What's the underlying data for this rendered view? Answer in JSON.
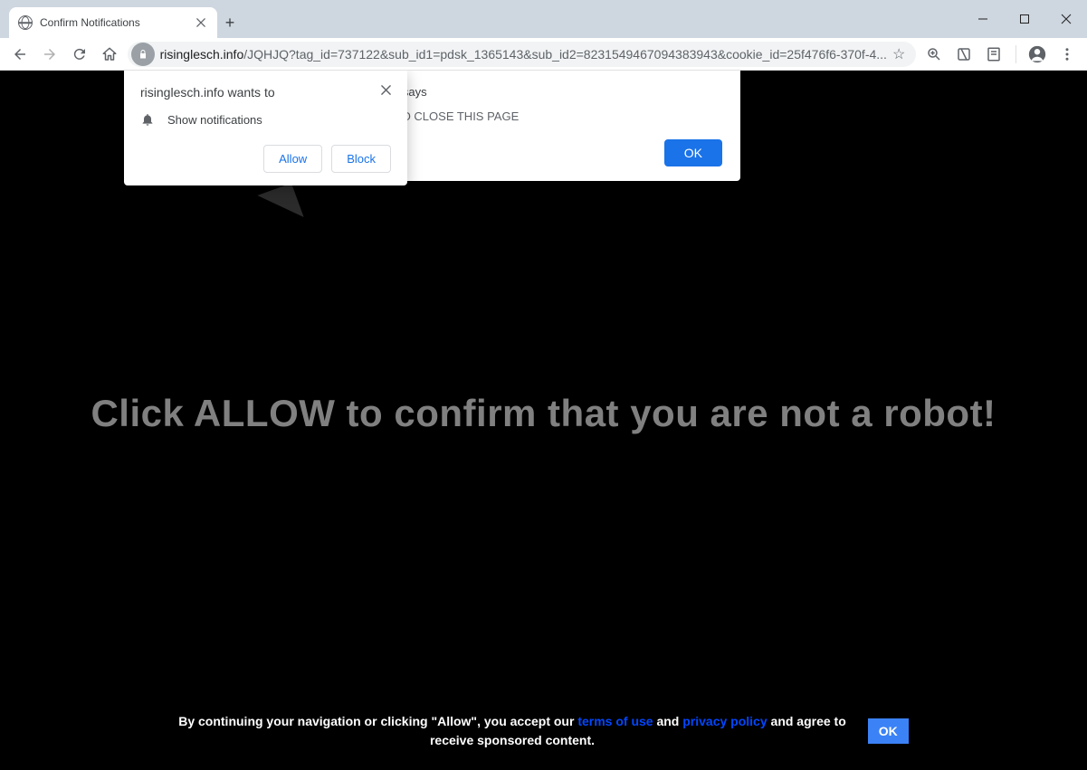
{
  "window": {
    "tab_title": "Confirm Notifications"
  },
  "toolbar": {
    "url_host": "risinglesch.info",
    "url_path": "/JQHJQ?tag_id=737122&sub_id1=pdsk_1365143&sub_id2=8231549467094383943&cookie_id=25f476f6-370f-4..."
  },
  "permission_prompt": {
    "title": "risinglesch.info wants to",
    "row_label": "Show notifications",
    "allow": "Allow",
    "block": "Block"
  },
  "js_alert": {
    "title_suffix": "ch.info says",
    "message_suffix": "LOW TO CLOSE THIS PAGE",
    "ok": "OK"
  },
  "page": {
    "main_text": "Click ALLOW to confirm that you are not a robot!",
    "footer_pre": "By continuing your navigation or clicking \"Allow\", you accept our ",
    "footer_terms": "terms of use",
    "footer_and": " and ",
    "footer_privacy": "privacy policy",
    "footer_post1": " and agree to",
    "footer_post2": "receive sponsored content.",
    "footer_ok": "OK"
  }
}
